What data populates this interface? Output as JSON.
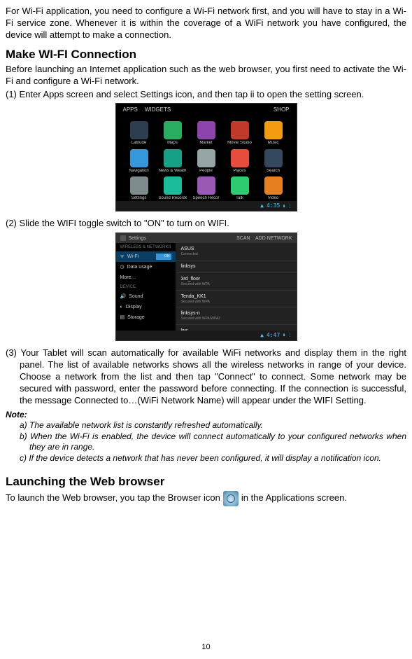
{
  "intro": "For Wi-Fi application, you need to configure a Wi-Fi network first, and you will have to stay in a Wi-Fi service zone. Whenever it is within the coverage of a WiFi network you have configured, the device will attempt to make a connection.",
  "section1": {
    "heading": "Make WI-FI Connection",
    "para": "Before launching an Internet application such as the web browser, you first need to activate the Wi-Fi and configure a Wi-Fi network.",
    "step1": "(1) Enter Apps screen and select Settings icon, and then tap ii to open the setting screen.",
    "step2": "(2) Slide the WIFI toggle switch to \"ON\" to turn on WIFI.",
    "step3": "(3) Your Tablet will scan automatically for available WiFi networks and display them in the right panel. The list of available networks shows all the wireless networks in range of your device. Choose a network from the list and then tap \"Connect\" to connect. Some network may be secured with password, enter the password before connecting. If the connection is successful, the message Connected to…(WiFi Network Name) will appear under the WIFI Setting."
  },
  "shot1": {
    "top_left": "APPS",
    "top_mid": "WIDGETS",
    "top_right": "SHOP",
    "apps": [
      {
        "label": "Latitude",
        "color": "#2c3e50"
      },
      {
        "label": "Maps",
        "color": "#27ae60"
      },
      {
        "label": "Market",
        "color": "#8e44ad"
      },
      {
        "label": "Movie Studio",
        "color": "#c0392b"
      },
      {
        "label": "Music",
        "color": "#f39c12"
      },
      {
        "label": "Navigation",
        "color": "#3498db"
      },
      {
        "label": "News & Weath",
        "color": "#16a085"
      },
      {
        "label": "People",
        "color": "#95a5a6"
      },
      {
        "label": "Places",
        "color": "#e74c3c"
      },
      {
        "label": "Search",
        "color": "#34495e"
      },
      {
        "label": "Settings",
        "color": "#7f8c8d"
      },
      {
        "label": "Sound Recorder",
        "color": "#1abc9c"
      },
      {
        "label": "Speech Recor",
        "color": "#9b59b6"
      },
      {
        "label": "Talk",
        "color": "#2ecc71"
      },
      {
        "label": "Video",
        "color": "#e67e22"
      }
    ],
    "time": "4:35"
  },
  "shot2": {
    "title": "Settings",
    "scan": "SCAN",
    "add": "ADD NETWORK",
    "left_section1": "WIRELESS & NETWORKS",
    "left_wifi": "Wi-Fi",
    "left_toggle": "ON",
    "left_data": "Data usage",
    "left_more": "More…",
    "left_section2": "DEVICE",
    "left_sound": "Sound",
    "left_display": "Display",
    "left_storage": "Storage",
    "networks": [
      {
        "name": "ASUS",
        "sub": "Connected"
      },
      {
        "name": "linksys",
        "sub": ""
      },
      {
        "name": "3rd_floor",
        "sub": "Secured with WPA"
      },
      {
        "name": "Tenda_KK1",
        "sub": "Secured with WPA"
      },
      {
        "name": "linksys-n",
        "sub": "Secured with WPA/WPA2"
      },
      {
        "name": "lws",
        "sub": ""
      }
    ],
    "time": "4:47"
  },
  "notes": {
    "title": "Note:",
    "a": "a)   The available network list is constantly refreshed automatically.",
    "b": "b)   When the Wi-Fi is enabled, the device will connect automatically to your configured networks when they are in range.",
    "c": "c)   If the device detects a network that has never been configured, it will display a notification icon."
  },
  "section2": {
    "heading": "Launching the Web browser",
    "before": "To launch the Web browser, you tap the Browser icon",
    "after": "in the Applications screen."
  },
  "page_num": "10"
}
